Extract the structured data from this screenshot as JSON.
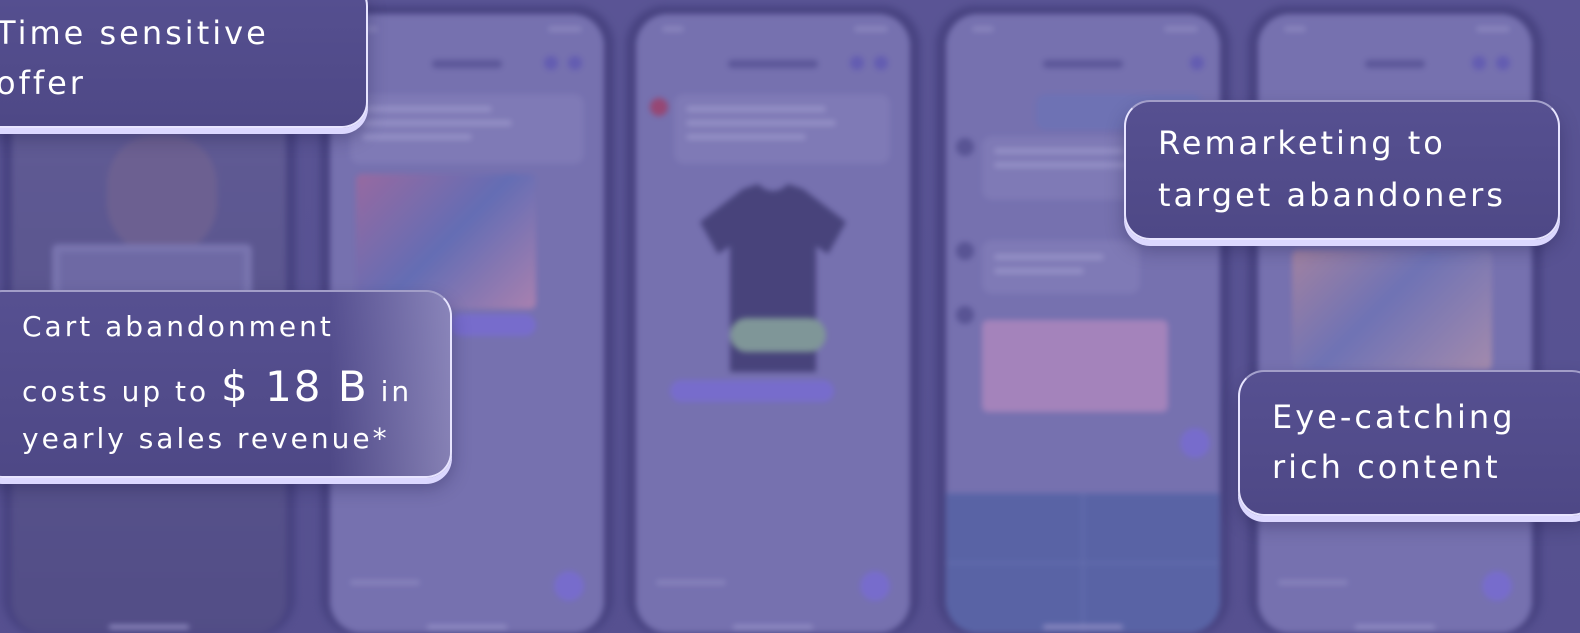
{
  "callouts": {
    "time_sensitive": {
      "line1": "Time sensitive",
      "line2": "offer"
    },
    "cart_abandonment": {
      "line1": "Cart abandonment",
      "line2_prefix": "costs up to",
      "amount": "$ 18 B",
      "line2_suffix": "in",
      "line3": "yearly sales revenue*"
    },
    "remarketing": {
      "line1": "Remarketing to",
      "line2": "target abandoners"
    },
    "eye_catching": {
      "line1": "Eye-catching",
      "line2": "rich content"
    }
  },
  "colors": {
    "background": "#5a5490",
    "callout_fill": "#524c8c",
    "callout_border": "#e8e5ff",
    "accent_purple": "#8d7ef0",
    "text": "#ffffff"
  },
  "icons": [
    "avatar-icon",
    "send-fab-icon",
    "header-icon"
  ]
}
